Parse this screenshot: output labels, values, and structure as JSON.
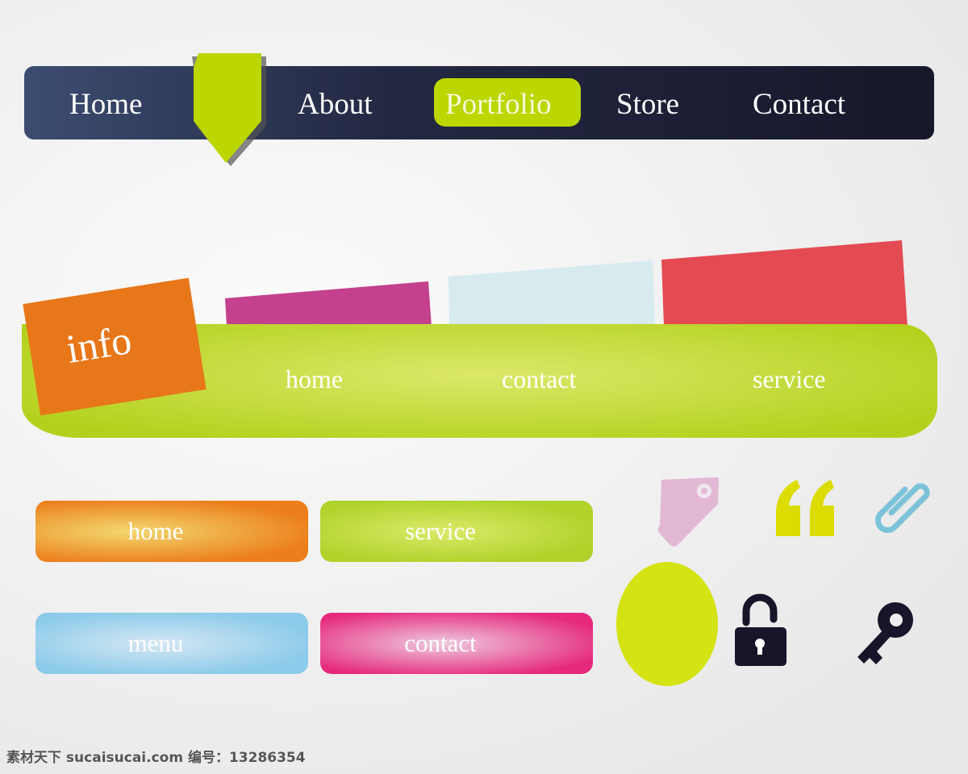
{
  "nav": {
    "items": [
      "Home",
      "About",
      "Portfolio",
      "Store",
      "Contact"
    ],
    "active": "Portfolio",
    "colors": {
      "bar": "#1a1a30",
      "accent": "#bcd600"
    }
  },
  "tabs": {
    "colors": [
      "#c4418e",
      "#d7ebef",
      "#e44a52"
    ]
  },
  "info_bar": {
    "tag": "info",
    "links": [
      "home",
      "contact",
      "service"
    ],
    "colors": {
      "bar": "#b3d11c",
      "tag": "#e87719"
    }
  },
  "buttons": [
    {
      "label": "home",
      "color": "#ec7f1c"
    },
    {
      "label": "service",
      "color": "#b0d22a"
    },
    {
      "label": "menu",
      "color": "#8ccbea"
    },
    {
      "label": "contact",
      "color": "#e6297d"
    }
  ],
  "icons": [
    "tag-icon",
    "quote-icon",
    "paperclip-icon",
    "circle-shape",
    "unlock-icon",
    "key-icon"
  ],
  "watermark": "素材天下 sucaisucai.com  编号：13286354"
}
